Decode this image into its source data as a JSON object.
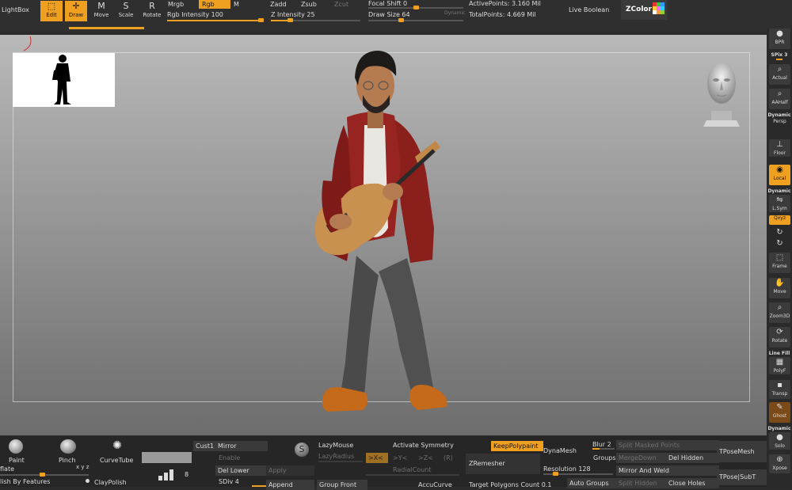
{
  "topbar": {
    "lightbox": "LightBox",
    "edit": "Edit",
    "draw": "Draw",
    "move": "Move",
    "scale": "Scale",
    "rotate": "Rotate",
    "mrgb": "Mrgb",
    "rgb": "Rgb",
    "m": "M",
    "rgb_intensity": "Rgb Intensity 100",
    "zadd": "Zadd",
    "zsub": "Zsub",
    "zcut": "Zcut",
    "z_intensity": "Z Intensity 25",
    "focal_shift": "Focal Shift 0",
    "draw_size": "Draw Size 64",
    "dynamic": "Dynamic",
    "active_points": "ActivePoints: 3.160 Mil",
    "total_points": "TotalPoints: 4.669 Mil",
    "live_boolean": "Live Boolean",
    "zcolor": "ZColor"
  },
  "levels": {
    "rgb_intensity": 1.0,
    "z_intensity": 0.25
  },
  "rshelf": {
    "bpr": "BPR",
    "spix": "SPix 3",
    "actual": "Actual",
    "aahalf": "AAHalf",
    "dynamic": "Dynamic",
    "persp": "Persp",
    "floor": "Floor",
    "local": "Local",
    "dynamic2": "Dynamic",
    "lsym": "L.Sym",
    "xyz": "Qxyz",
    "frame": "Frame",
    "move": "Move",
    "zoom3d": "Zoom3D",
    "rotate": "Rotate",
    "line_fill": "Line Fill",
    "polyf": "PolyF",
    "transp": "Transp",
    "ghost": "Ghost",
    "dynamic3": "Dynamic",
    "solo": "Solo",
    "xpose": "Xpose"
  },
  "bottombar": {
    "paint": "Paint",
    "pinch": "Pinch",
    "curvetube": "CurveTube",
    "inflate": "flate",
    "clay_polish": "ClayPolish",
    "polish_by_features": "lish By Features",
    "count8": "8",
    "cust1": "Cust1",
    "mirror": "Mirror",
    "enable": "Enable",
    "del_lower": "Del Lower",
    "apply": "Apply",
    "sdiv": "SDiv 4",
    "append": "Append",
    "lazymouse": "LazyMouse",
    "lazyradius": "LazyRadius",
    "activate_symmetry": "Activate Symmetry",
    "x": ">X<",
    "y": ">Y<",
    "z": ">Z<",
    "r": "(R)",
    "radialcount": "RadialCount",
    "group_front": "Group Front",
    "accucurve": "AccuCurve",
    "keep_polypaint": "KeepPolypaint",
    "zremesher": "ZRemesher",
    "target_polygons": "Target Polygons Count 0.1",
    "dynamesh": "DynaMesh",
    "resolution": "Resolution 128",
    "groups": "Groups",
    "blur": "Blur 2",
    "merge_down": "MergeDown",
    "auto_groups": "Auto Groups",
    "split_masked": "Split Masked Points",
    "mirror_and_weld": "Mirror And Weld",
    "split_hidden": "Split Hidden",
    "del_hidden": "Del Hidden",
    "close_holes": "Close Holes",
    "tposemesh": "TPoseMesh",
    "tpose_subt": "TPose|SubT"
  }
}
